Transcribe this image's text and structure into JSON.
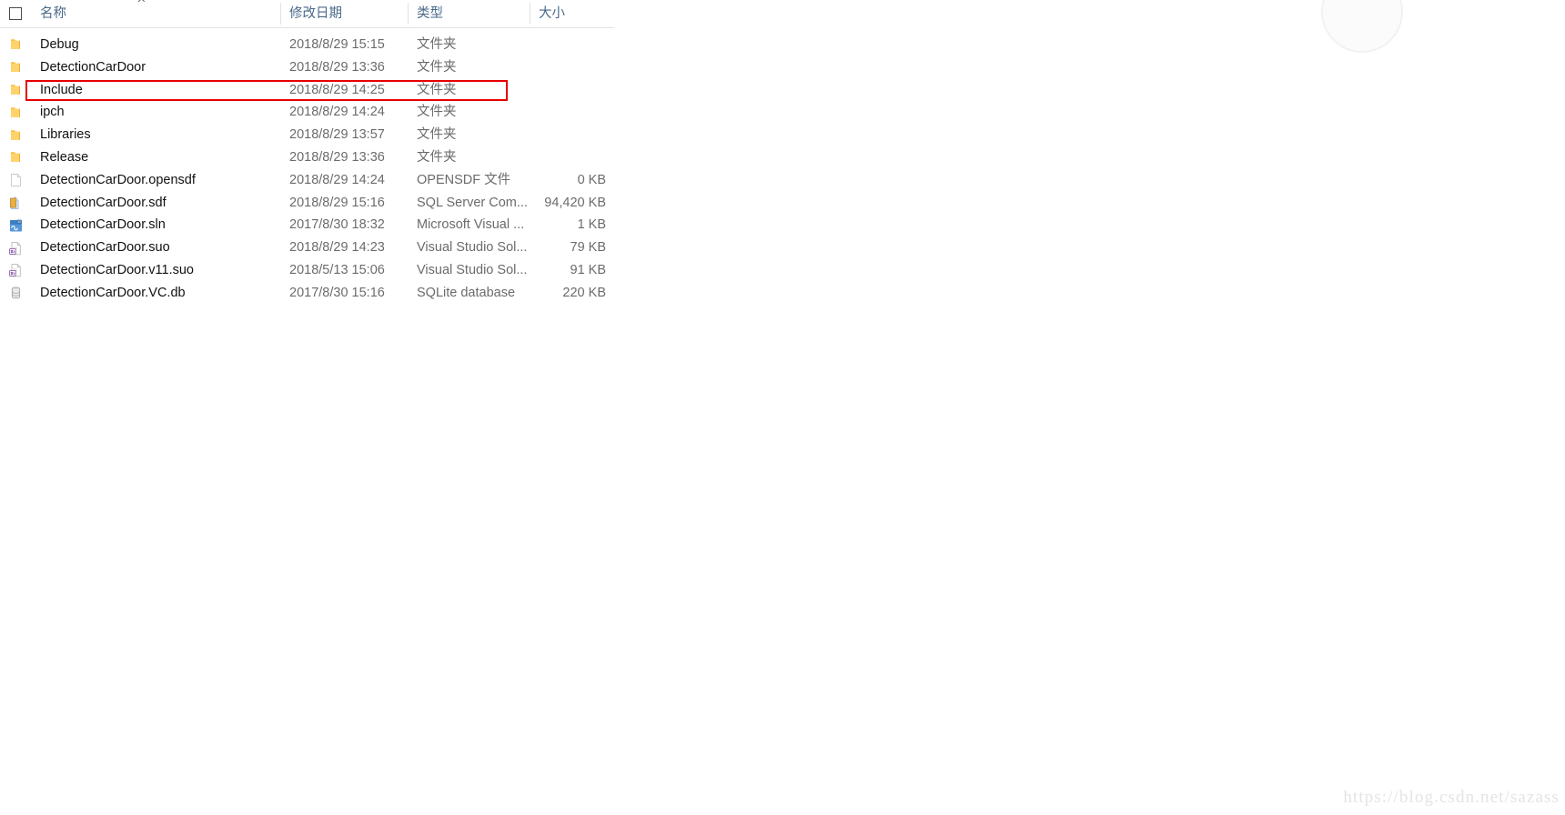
{
  "window": {
    "kind": "windows-file-explorer-details-view"
  },
  "header": {
    "sort_indicator": "^",
    "select_all_checkbox": "",
    "columns": [
      {
        "label": "名称",
        "key": "name"
      },
      {
        "label": "修改日期",
        "key": "date"
      },
      {
        "label": "类型",
        "key": "type"
      },
      {
        "label": "大小",
        "key": "size"
      }
    ]
  },
  "files": [
    {
      "icon": "folder-icon",
      "name": "Debug",
      "date": "2018/8/29 15:15",
      "type": "文件夹",
      "size": ""
    },
    {
      "icon": "folder-icon",
      "name": "DetectionCarDoor",
      "date": "2018/8/29 13:36",
      "type": "文件夹",
      "size": ""
    },
    {
      "icon": "folder-icon",
      "name": "Include",
      "date": "2018/8/29 14:25",
      "type": "文件夹",
      "size": ""
    },
    {
      "icon": "folder-icon",
      "name": "ipch",
      "date": "2018/8/29 14:24",
      "type": "文件夹",
      "size": ""
    },
    {
      "icon": "folder-icon",
      "name": "Libraries",
      "date": "2018/8/29 13:57",
      "type": "文件夹",
      "size": ""
    },
    {
      "icon": "folder-icon",
      "name": "Release",
      "date": "2018/8/29 13:36",
      "type": "文件夹",
      "size": ""
    },
    {
      "icon": "blank-document-icon",
      "name": "DetectionCarDoor.opensdf",
      "date": "2018/8/29 14:24",
      "type": "OPENSDF 文件",
      "size": "0 KB"
    },
    {
      "icon": "sql-database-icon",
      "name": "DetectionCarDoor.sdf",
      "date": "2018/8/29 15:16",
      "type": "SQL Server Com...",
      "size": "94,420 KB"
    },
    {
      "icon": "visual-studio-icon",
      "name": "DetectionCarDoor.sln",
      "date": "2017/8/30 18:32",
      "type": "Microsoft Visual ...",
      "size": "1 KB"
    },
    {
      "icon": "solution-options-icon",
      "name": "DetectionCarDoor.suo",
      "date": "2018/8/29 14:23",
      "type": "Visual Studio Sol...",
      "size": "79 KB"
    },
    {
      "icon": "solution-options-icon",
      "name": "DetectionCarDoor.v11.suo",
      "date": "2018/5/13 15:06",
      "type": "Visual Studio Sol...",
      "size": "91 KB"
    },
    {
      "icon": "sqlite-database-icon",
      "name": "DetectionCarDoor.VC.db",
      "date": "2017/8/30 15:16",
      "type": "SQLite database",
      "size": "220 KB"
    }
  ],
  "annotation": {
    "highlight_row_name": "Include",
    "highlight_color": "#e60000"
  },
  "watermark": {
    "text": "https://blog.csdn.net/sazass",
    "color": "#e4e4e4"
  },
  "colors": {
    "header_text": "#4a6a8a",
    "row_name_text": "#111111",
    "row_meta_text": "#6b6b6b",
    "folder_yellow": "#ffc945",
    "divider": "#e2e2e2"
  }
}
